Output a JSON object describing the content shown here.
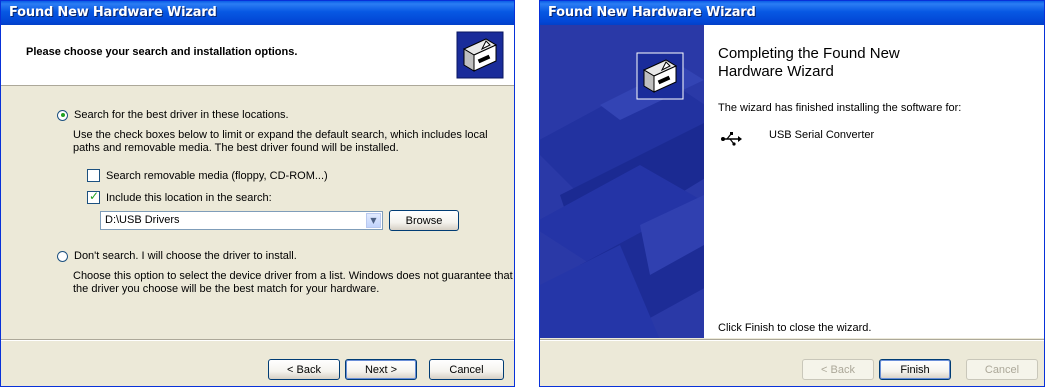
{
  "left_window": {
    "title": "Found New Hardware Wizard",
    "header_title": "Please choose your search and installation options.",
    "option_search_label": "Search for the best driver in these locations.",
    "option_search_desc_1": "Use the check boxes below to limit or expand the default search, which includes local",
    "option_search_desc_2": "paths and removable media. The best driver found will be installed.",
    "check_removable_label": "Search removable media (floppy, CD-ROM...)",
    "check_removable_checked": false,
    "check_location_label": "Include this location in the search:",
    "check_location_checked": true,
    "location_value": "D:\\USB Drivers",
    "browse_label": "Browse",
    "option_dont_search_label": "Don't search. I will choose the driver to install.",
    "option_dont_desc_1": "Choose this option to select the device driver from a list.  Windows does not guarantee that",
    "option_dont_desc_2": "the driver you choose will be the best match for your hardware.",
    "back_label": "< Back",
    "next_label": "Next >",
    "cancel_label": "Cancel"
  },
  "right_window": {
    "title": "Found New Hardware Wizard",
    "heading_line1": "Completing the Found New",
    "heading_line2": "Hardware Wizard",
    "finished_text": "The wizard has finished installing the software for:",
    "device_name": "USB Serial Converter",
    "device_icon": "usb-icon",
    "close_text": "Click Finish to close the wizard.",
    "back_label": "< Back",
    "finish_label": "Finish",
    "cancel_label": "Cancel"
  },
  "colors": {
    "titlebar": "#0a5ee6",
    "sidebar": "#2a39a7",
    "dialog_bg": "#ece9d8"
  }
}
